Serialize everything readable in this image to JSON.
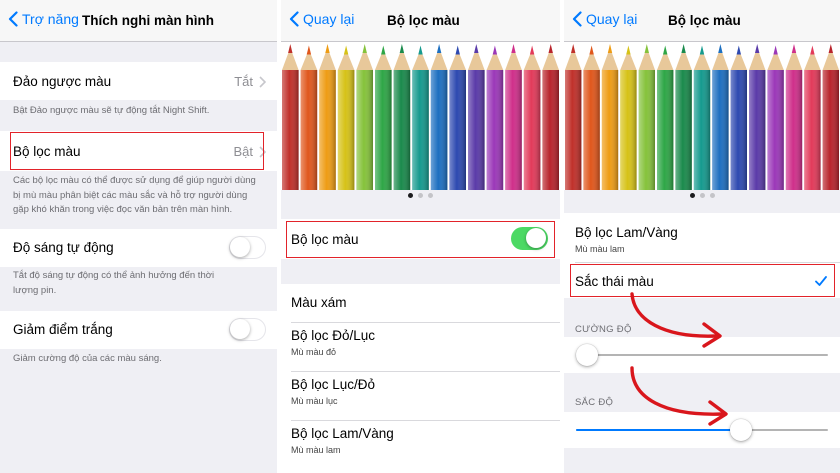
{
  "colors": {
    "accent": "#007aff",
    "highlight": "#e2232a",
    "switch_on": "#4cd964",
    "arrow": "#d9161c"
  },
  "screen1": {
    "back_label": "Trợ năng",
    "title": "Thích nghi màn hình",
    "invert": {
      "label": "Đảo ngược màu",
      "value": "Tắt"
    },
    "invert_note": "Bật Đảo ngược màu sẽ tự động tắt Night Shift.",
    "filters": {
      "label": "Bộ lọc màu",
      "value": "Bật"
    },
    "filters_note_lines": [
      "Các bộ lọc màu có thể được sử dụng để giúp người dùng",
      "bị mù màu phân biệt các màu sắc và hỗ trợ người dùng",
      "gặp khó khăn trong việc đọc văn bản trên màn hình."
    ],
    "auto_brightness": {
      "label": "Độ sáng tự động",
      "on": false
    },
    "auto_brightness_note_lines": [
      "Tắt độ sáng tự động có thể ảnh hưởng đến thời",
      "lượng pin."
    ],
    "reduce_white": {
      "label": "Giảm điểm trắng",
      "on": false
    },
    "reduce_white_note": "Giảm cường độ của các màu sáng."
  },
  "screen2": {
    "back_label": "Quay lại",
    "title": "Bộ lọc màu",
    "toggle": {
      "label": "Bộ lọc màu",
      "on": true
    },
    "options": [
      {
        "label": "Màu xám",
        "sub": ""
      },
      {
        "label": "Bộ lọc Đỏ/Lục",
        "sub": "Mù màu đỏ"
      },
      {
        "label": "Bộ lọc Lục/Đỏ",
        "sub": "Mù màu lục"
      },
      {
        "label": "Bộ lọc Lam/Vàng",
        "sub": "Mù màu lam"
      }
    ],
    "page_dots": {
      "count": 3,
      "active": 0
    }
  },
  "screen3": {
    "back_label": "Quay lại",
    "title": "Bộ lọc màu",
    "options": [
      {
        "label": "Bộ lọc Lam/Vàng",
        "sub": "Mù màu lam"
      },
      {
        "label": "Sắc thái màu",
        "sub": "",
        "selected": true
      }
    ],
    "intensity": {
      "label": "CƯỜNG ĐỘ",
      "value": 0.0
    },
    "hue": {
      "label": "SẮC ĐỘ",
      "value": 0.67
    },
    "page_dots": {
      "count": 3,
      "active": 0
    }
  },
  "icons": {
    "back": "chevron-left-icon",
    "disclosure": "chevron-right-icon",
    "checkmark": "checkmark-icon",
    "annotation": "curved-arrow-icon",
    "hero": "colored-pencils-image"
  },
  "pencil_colors": [
    "#c0302a",
    "#e0571c",
    "#ee9c14",
    "#d6c217",
    "#85c23b",
    "#2ea646",
    "#1a8a4c",
    "#159a8e",
    "#1d6fc0",
    "#2d49b0",
    "#5a3aa8",
    "#9b38b8",
    "#cf2f8a",
    "#e23a5a",
    "#b8242c"
  ]
}
